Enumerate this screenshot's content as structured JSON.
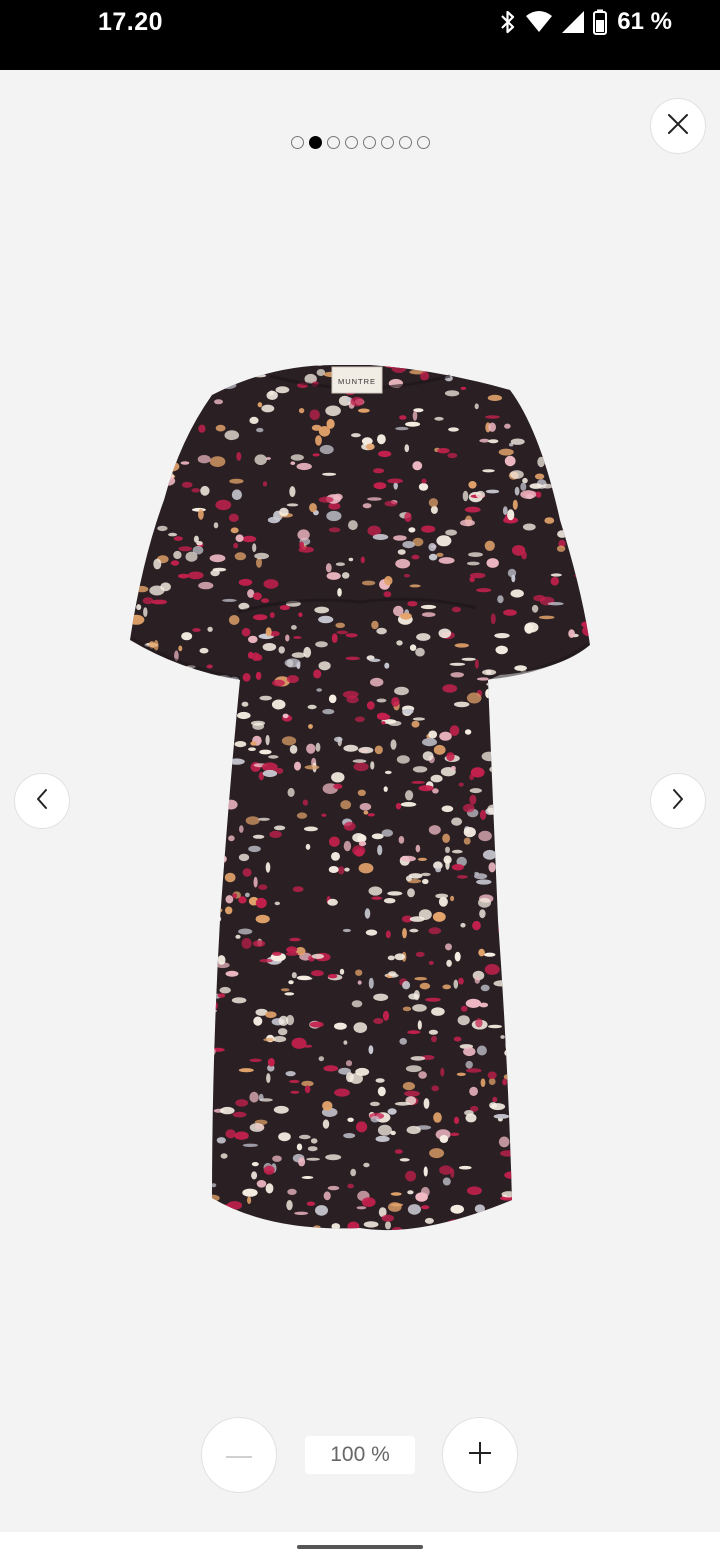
{
  "status_bar": {
    "time": "17.20",
    "battery": "61 %",
    "icons": [
      "bluetooth-icon",
      "wifi-icon",
      "signal-icon",
      "battery-icon"
    ]
  },
  "gallery": {
    "dot_count": 8,
    "active_index": 1,
    "image_label": "MUNTRE"
  },
  "controls": {
    "close_icon": "close-icon",
    "prev_icon": "chevron-left-icon",
    "next_icon": "chevron-right-icon",
    "zoom_out_icon": "minus-icon",
    "zoom_in_icon": "plus-icon",
    "zoom_level": "100 %"
  },
  "colors": {
    "background": "#f3f3f3",
    "active_dot": "#000000",
    "dress_base": "#2a2024",
    "print_red": "#c4204d",
    "print_pink": "#f0b9c4",
    "print_cream": "#f6eee3",
    "print_orange": "#e3a36b",
    "print_grey": "#c9c9d3"
  }
}
